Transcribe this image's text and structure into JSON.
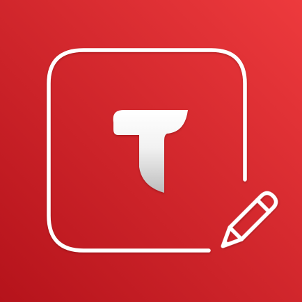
{
  "icon": {
    "letter": "T",
    "shape": "rounded-square-outline",
    "accessory": "pencil-icon"
  },
  "colors": {
    "background_start": "#b5131b",
    "background_end": "#ed3a3d",
    "outline": "#ffffff",
    "letter_light": "#ffffff",
    "letter_shade": "#bdbdbd"
  }
}
